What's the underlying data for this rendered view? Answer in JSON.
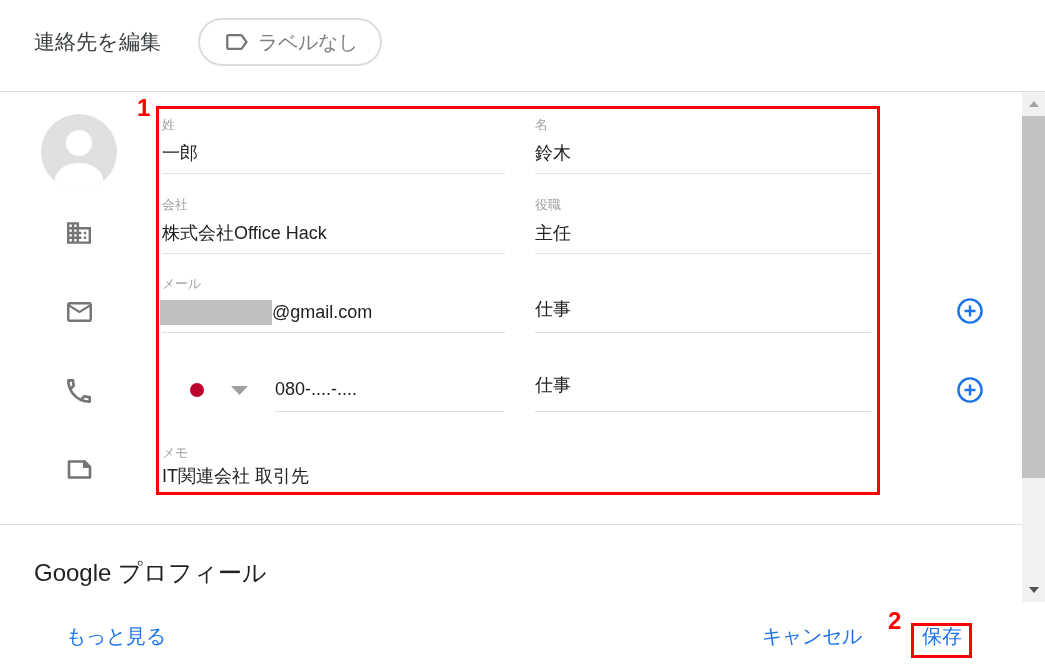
{
  "header": {
    "title": "連絡先を編集",
    "label_chip": "ラベルなし"
  },
  "rows": [
    {
      "kind": "name",
      "add_button": false,
      "fields": [
        {
          "label": "姓",
          "value": "一郎"
        },
        {
          "label": "名",
          "value": "鈴木"
        }
      ]
    },
    {
      "kind": "company",
      "add_button": false,
      "fields": [
        {
          "label": "会社",
          "value": "株式会社Office Hack"
        },
        {
          "label": "役職",
          "value": "主任"
        }
      ]
    },
    {
      "kind": "email",
      "add_button": true,
      "fields": [
        {
          "label": "メール",
          "value": "@gmail.com",
          "redacted": true
        },
        {
          "value": "仕事"
        }
      ]
    },
    {
      "kind": "phone",
      "add_button": true,
      "fields": [
        {
          "value": "080-....-...."
        },
        {
          "value": "仕事"
        }
      ]
    },
    {
      "kind": "note",
      "add_button": false,
      "fields": [
        {
          "label": "メモ",
          "value": "IT関連会社 取引先"
        }
      ]
    }
  ],
  "profile_section": {
    "title": "Google プロフィール"
  },
  "footer": {
    "more_link": "もっと見る",
    "buttons": [
      "キャンセル",
      "保存"
    ]
  },
  "annotations": [
    {
      "kind": "form_frame",
      "number": "1"
    },
    {
      "kind": "save_frame",
      "number": "2"
    }
  ]
}
